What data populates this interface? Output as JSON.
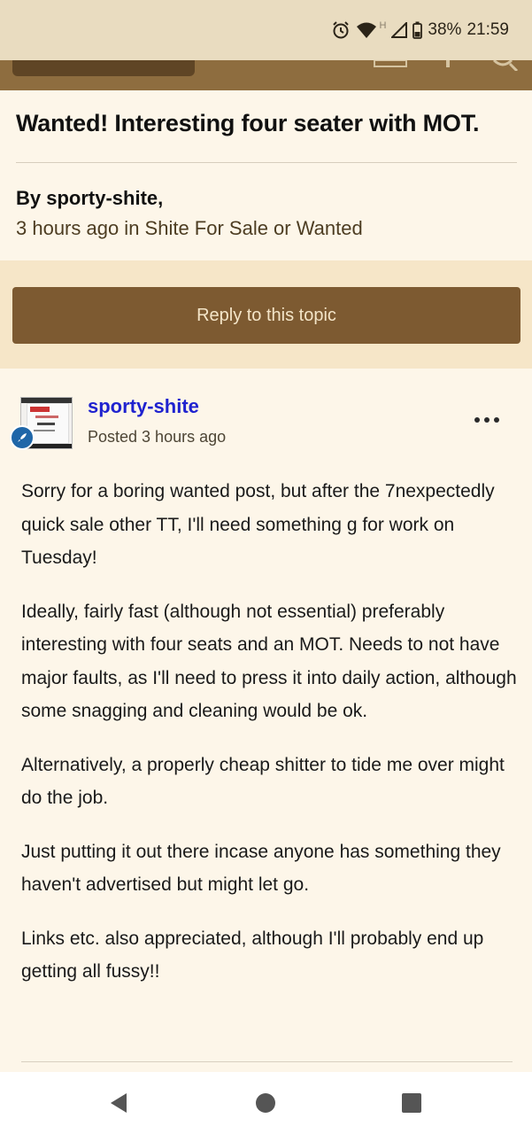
{
  "status_bar": {
    "battery": "38%",
    "time": "21:59",
    "network_label": "H",
    "icons": [
      "alarm-icon",
      "wifi-icon",
      "signal-icon",
      "battery-icon"
    ]
  },
  "topic": {
    "title": "Wanted! Interesting four seater with MOT.",
    "byline": "By sporty-shite,",
    "meta": "3 hours ago in Shite For Sale or Wanted"
  },
  "reply_button": {
    "label": "Reply to this topic"
  },
  "post": {
    "author": "sporty-shite",
    "posted": "Posted 3 hours ago",
    "paragraphs": [
      "Sorry for a boring wanted post, but after the 7nexpectedly quick sale other TT,  I'll need something g for work on Tuesday!",
      "Ideally, fairly fast (although not essential) preferably interesting with four seats and an MOT. Needs to not have major faults, as I'll need to press it into daily action, although some snagging and cleaning would be ok.",
      "Alternatively,  a properly cheap shitter to tide me over might do the job.",
      "Just putting it out there incase anyone has something they haven't advertised but might let go.",
      "Links etc. also appreciated,  although I'll probably end up getting all fussy!!"
    ]
  },
  "colors": {
    "page_bg": "#fbf3e4",
    "header": "#8e6d3f",
    "reply_button": "#7d5a31",
    "author_link": "#1f22cf",
    "rank_badge": "#1f66a8"
  }
}
